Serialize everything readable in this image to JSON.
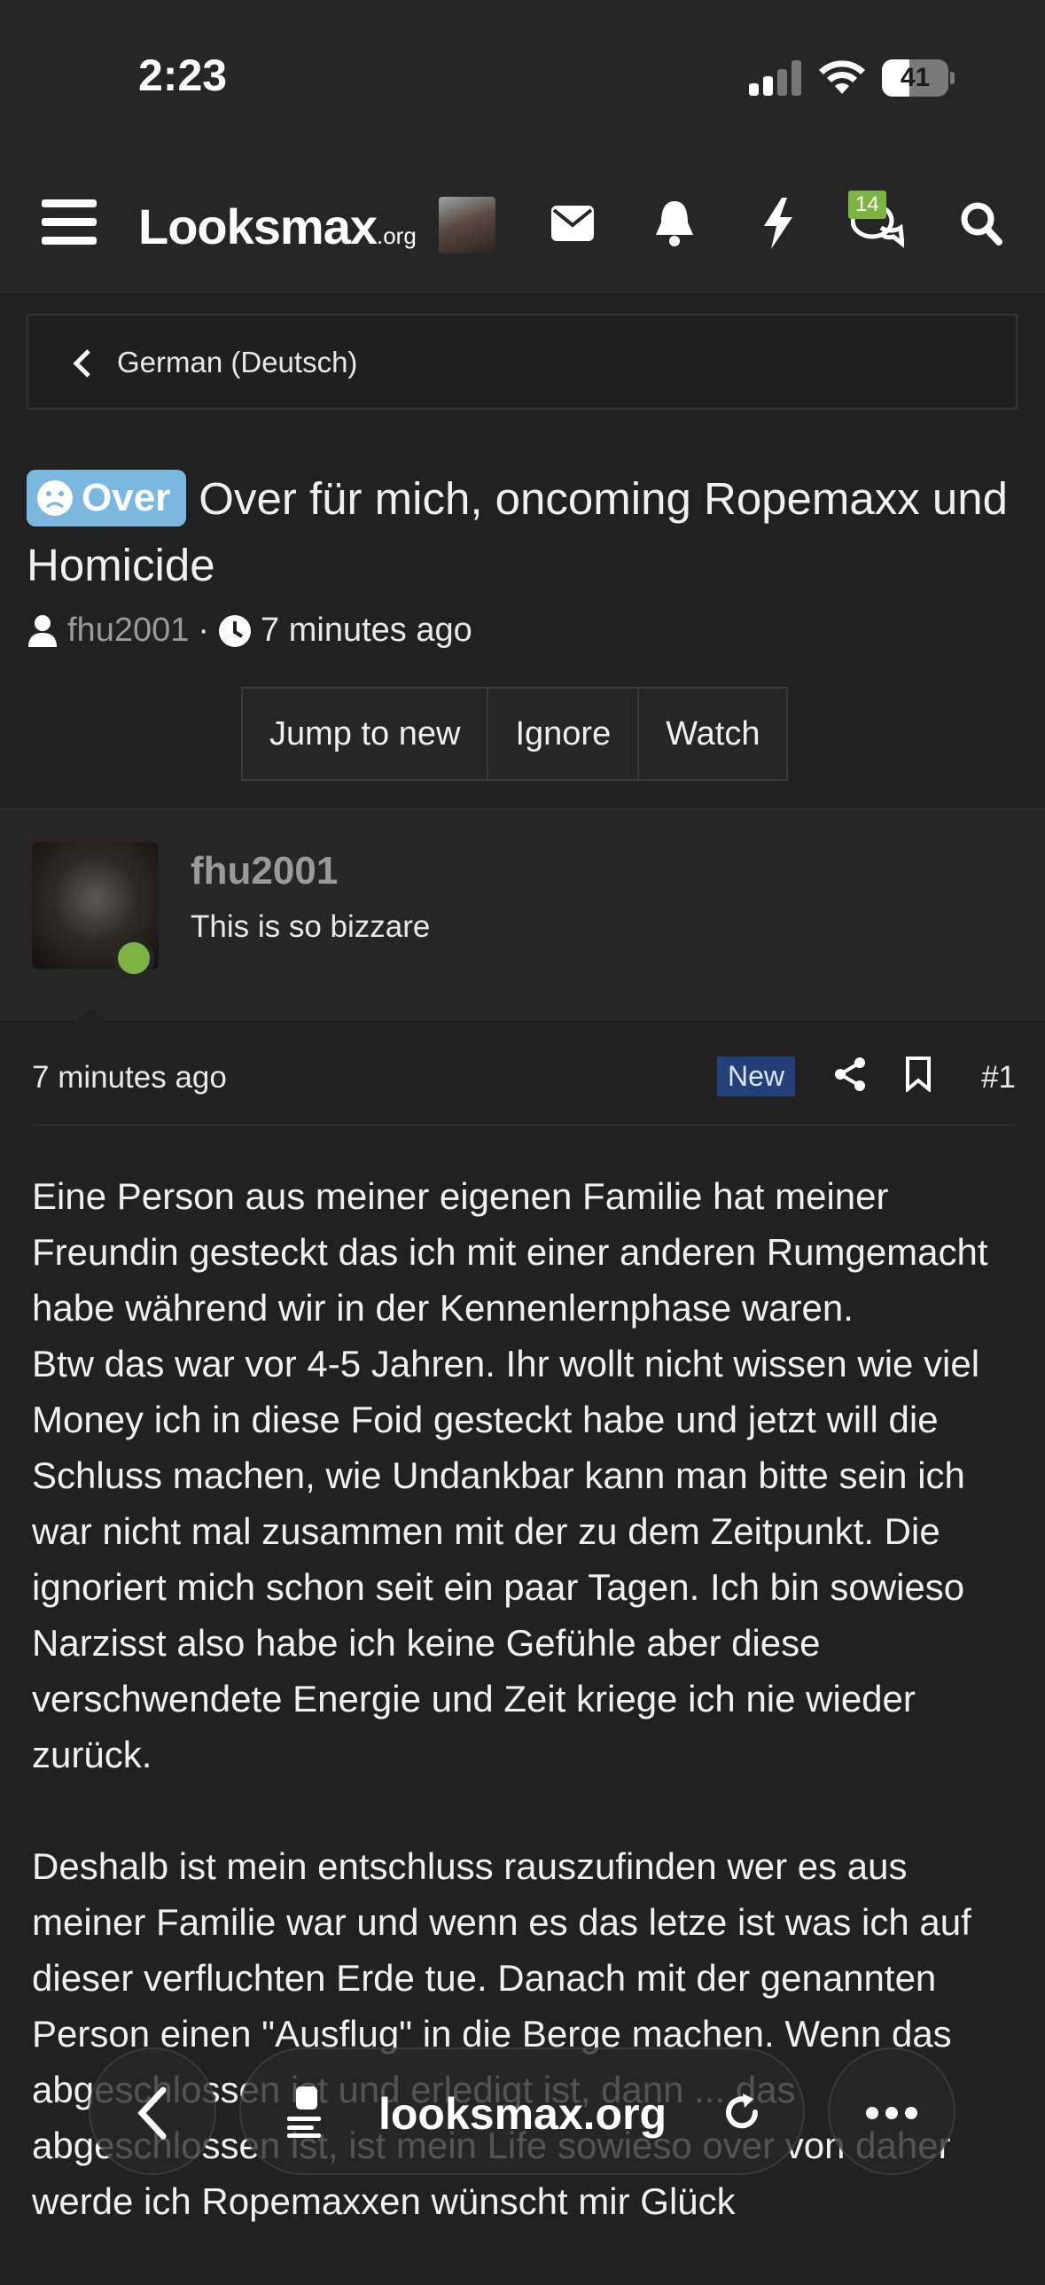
{
  "status_bar": {
    "time": "2:23",
    "battery": "41",
    "battery_level": 0.41
  },
  "navbar": {
    "logo_main": "Looksmax",
    "logo_suffix": ".org",
    "conversations_badge": "14"
  },
  "breadcrumb": {
    "label": "German (Deutsch)"
  },
  "thread": {
    "prefix": "Over",
    "title": "Over für mich, oncoming Ropemaxx und Homicide",
    "author": "fhu2001",
    "separator": "·",
    "time": "7 minutes ago"
  },
  "actions": {
    "jump": "Jump to new",
    "ignore": "Ignore",
    "watch": "Watch"
  },
  "post": {
    "username": "fhu2001",
    "user_title": "This is so bizzare",
    "date": "7 minutes ago",
    "new_label": "New",
    "number": "#1",
    "paragraphs": [
      "Eine Person aus meiner eigenen Familie hat meiner Freundin gesteckt das ich mit einer anderen Rumgemacht habe während wir in der Kennenlernphase waren.\nBtw das war vor 4-5 Jahren. Ihr wollt nicht wissen wie viel Money ich in diese Foid gesteckt habe und jetzt will die Schluss machen, wie Undankbar kann man bitte sein ich war nicht mal zusammen mit der zu dem Zeitpunkt. Die ignoriert mich schon seit ein paar Tagen. Ich bin sowieso Narzisst also habe ich keine Gefühle aber diese verschwendete Energie und Zeit kriege ich nie wieder zurück.",
      "Deshalb ist mein entschluss rauszufinden wer es aus meiner Familie war und wenn es das letze ist was ich auf dieser verfluchten Erde tue. Danach mit der genannten Person einen \"Ausflug\" in die Berge machen. Wenn das abgeschlossen ist und erledigt ist, dann ... das abgeschlossen ist, ist mein Life sowieso over von daher werde ich Ropemaxxen wünscht mir Glück"
    ]
  },
  "browser": {
    "url": "looksmax.org"
  },
  "colors": {
    "background": "#212121",
    "header": "#262626",
    "prefix": "#7ab8e0",
    "online": "#7cb342",
    "new_badge": "#23407a"
  }
}
